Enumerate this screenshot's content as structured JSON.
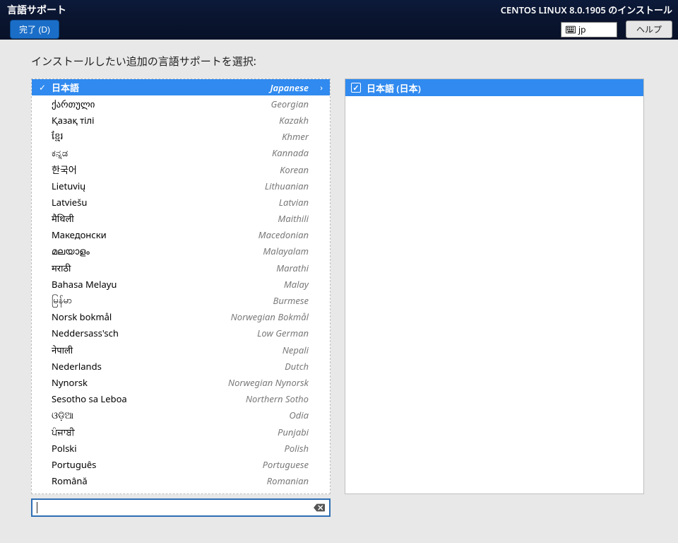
{
  "header": {
    "title": "言語サポート",
    "done_label": "完了 (D)",
    "install_title": "CENTOS LINUX 8.0.1905 のインストール",
    "keyboard_code": "jp",
    "help_label": "ヘルプ"
  },
  "instruction": "インストールしたい追加の言語サポートを選択:",
  "languages": [
    {
      "native": "日本語",
      "english": "Japanese",
      "selected": true,
      "checked": true
    },
    {
      "native": "ქართული",
      "english": "Georgian"
    },
    {
      "native": "Қазақ тілі",
      "english": "Kazakh"
    },
    {
      "native": "ខ្មែរ",
      "english": "Khmer"
    },
    {
      "native": "ಕನ್ನಡ",
      "english": "Kannada"
    },
    {
      "native": "한국어",
      "english": "Korean"
    },
    {
      "native": "Lietuvių",
      "english": "Lithuanian"
    },
    {
      "native": "Latviešu",
      "english": "Latvian"
    },
    {
      "native": "मैथिली",
      "english": "Maithili"
    },
    {
      "native": "Македонски",
      "english": "Macedonian"
    },
    {
      "native": "മലയാളം",
      "english": "Malayalam"
    },
    {
      "native": "मराठी",
      "english": "Marathi"
    },
    {
      "native": "Bahasa Melayu",
      "english": "Malay"
    },
    {
      "native": "မြန်မာ",
      "english": "Burmese"
    },
    {
      "native": "Norsk bokmål",
      "english": "Norwegian Bokmål"
    },
    {
      "native": "Neddersass'sch",
      "english": "Low German"
    },
    {
      "native": "नेपाली",
      "english": "Nepali"
    },
    {
      "native": "Nederlands",
      "english": "Dutch"
    },
    {
      "native": "Nynorsk",
      "english": "Norwegian Nynorsk"
    },
    {
      "native": "Sesotho sa Leboa",
      "english": "Northern Sotho"
    },
    {
      "native": "ଓଡ଼ିଆ",
      "english": "Odia"
    },
    {
      "native": "ਪੰਜਾਬੀ",
      "english": "Punjabi"
    },
    {
      "native": "Polski",
      "english": "Polish"
    },
    {
      "native": "Português",
      "english": "Portuguese"
    },
    {
      "native": "Română",
      "english": "Romanian"
    }
  ],
  "locales": [
    {
      "label": "日本語 (日本)",
      "checked": true,
      "selected": true
    }
  ],
  "search": {
    "value": "",
    "placeholder": ""
  }
}
